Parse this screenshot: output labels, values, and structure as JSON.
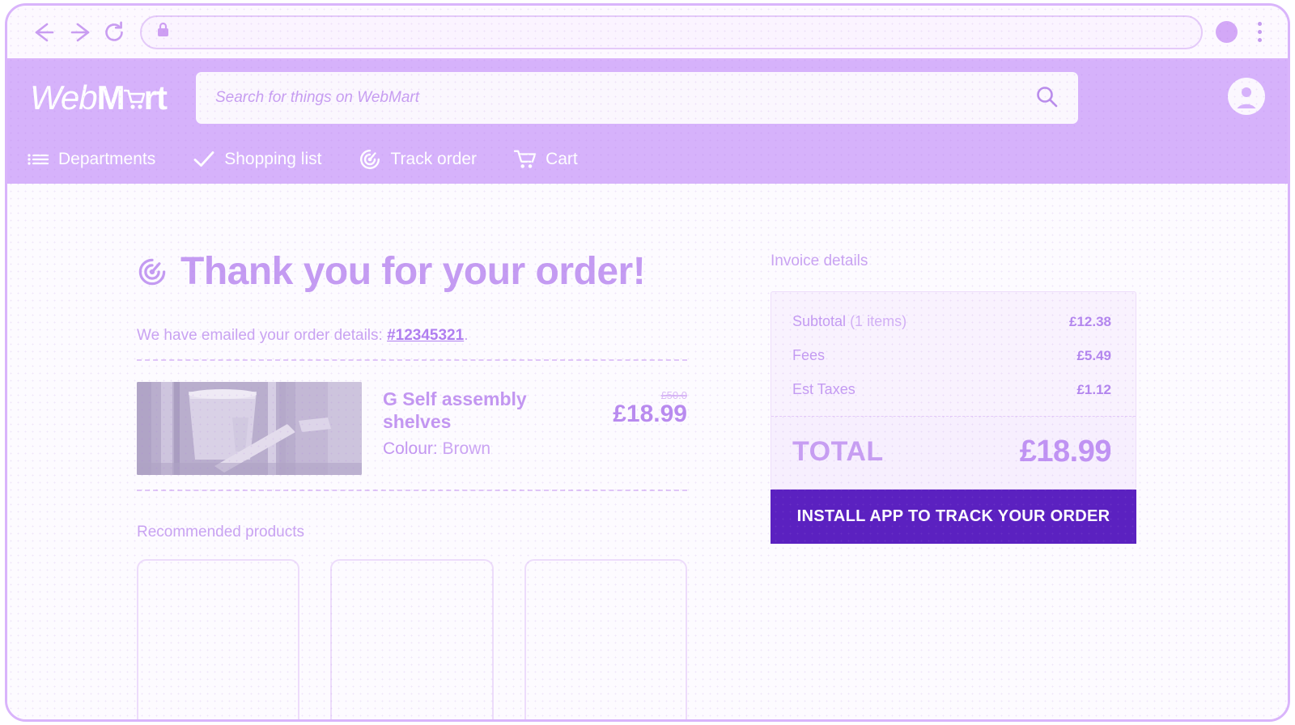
{
  "browser": {
    "back_icon": "arrow-left-icon",
    "forward_icon": "arrow-right-icon",
    "reload_icon": "reload-icon",
    "lock_icon": "lock-icon",
    "url_value": "",
    "profile_icon": "profile-avatar-icon",
    "menu_icon": "kebab-menu-icon"
  },
  "header": {
    "logo": {
      "part1": "Web",
      "part2": "M",
      "cart_icon": "shopping-cart-icon",
      "part3": "rt"
    },
    "search": {
      "placeholder": "Search for things on WebMart",
      "value": "",
      "icon": "search-icon"
    },
    "account_icon": "user-account-icon",
    "nav": [
      {
        "label": "Departments",
        "icon": "list-menu-icon"
      },
      {
        "label": "Shopping list",
        "icon": "checkmark-icon"
      },
      {
        "label": "Track order",
        "icon": "radar-target-icon"
      },
      {
        "label": "Cart",
        "icon": "shopping-cart-icon"
      }
    ]
  },
  "main": {
    "thanks_icon": "radar-target-icon",
    "thanks_title": "Thank you for your order!",
    "emailed_prefix": "We have emailed your order details: ",
    "order_number": "#12345321",
    "emailed_suffix": ".",
    "product": {
      "image_alt": "self-assembly-shelves-photo",
      "title": "G Self assembly shelves",
      "colour_label": "Colour:",
      "colour_value": "Brown",
      "price_old": "£50.0",
      "price_new": "£18.99"
    },
    "recommended_heading": "Recommended products",
    "recommended_cards": [
      {
        "name": "recommended-card-1"
      },
      {
        "name": "recommended-card-2"
      },
      {
        "name": "recommended-card-3"
      }
    ]
  },
  "invoice": {
    "heading": "Invoice details",
    "rows": [
      {
        "label": "Subtotal",
        "sublabel": " (1 items)",
        "value": "£12.38"
      },
      {
        "label": "Fees",
        "sublabel": "",
        "value": "£5.49"
      },
      {
        "label": "Est Taxes",
        "sublabel": "",
        "value": "£1.12"
      }
    ],
    "total_label": "TOTAL",
    "total_value": "£18.99",
    "cta_label": "INSTALL APP TO TRACK YOUR ORDER"
  },
  "colors": {
    "brand_purple": "#d6b2fb",
    "accent_text": "#c49bf2",
    "cta_purple": "#5b21c0",
    "page_bg": "#fdfbff",
    "frame_border": "#d9b4fb"
  }
}
